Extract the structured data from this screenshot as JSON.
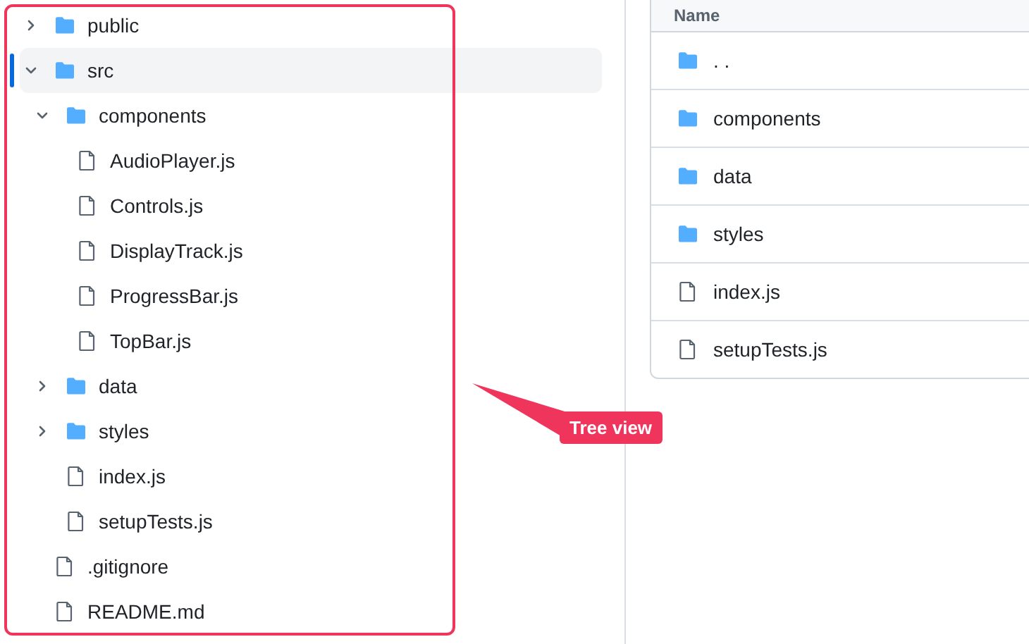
{
  "tree": {
    "items": [
      {
        "name": "public",
        "kind": "folder",
        "expanded": false,
        "selected": false
      },
      {
        "name": "src",
        "kind": "folder",
        "expanded": true,
        "selected": true,
        "children": [
          {
            "name": "components",
            "kind": "folder",
            "expanded": true,
            "selected": false,
            "children": [
              {
                "name": "AudioPlayer.js",
                "kind": "file",
                "selected": false
              },
              {
                "name": "Controls.js",
                "kind": "file",
                "selected": false
              },
              {
                "name": "DisplayTrack.js",
                "kind": "file",
                "selected": false
              },
              {
                "name": "ProgressBar.js",
                "kind": "file",
                "selected": false
              },
              {
                "name": "TopBar.js",
                "kind": "file",
                "selected": false
              }
            ]
          },
          {
            "name": "data",
            "kind": "folder",
            "expanded": false,
            "selected": false
          },
          {
            "name": "styles",
            "kind": "folder",
            "expanded": false,
            "selected": false
          },
          {
            "name": "index.js",
            "kind": "file",
            "selected": false
          },
          {
            "name": "setupTests.js",
            "kind": "file",
            "selected": false
          }
        ]
      },
      {
        "name": ".gitignore",
        "kind": "file",
        "selected": false
      },
      {
        "name": "README.md",
        "kind": "file",
        "selected": false
      }
    ]
  },
  "table": {
    "columns": [
      "Name"
    ],
    "rows": [
      {
        "name": ". .",
        "kind": "folder"
      },
      {
        "name": "components",
        "kind": "folder"
      },
      {
        "name": "data",
        "kind": "folder"
      },
      {
        "name": "styles",
        "kind": "folder"
      },
      {
        "name": "index.js",
        "kind": "file"
      },
      {
        "name": "setupTests.js",
        "kind": "file"
      }
    ]
  },
  "annotation": {
    "label": "Tree view"
  }
}
